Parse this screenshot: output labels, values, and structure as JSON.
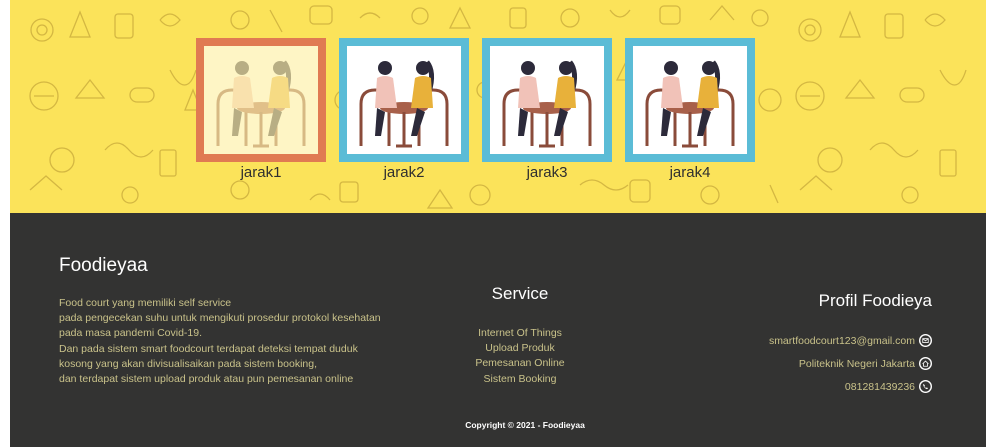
{
  "seats": [
    {
      "label": "jarak1",
      "status": "taken"
    },
    {
      "label": "jarak2",
      "status": "available"
    },
    {
      "label": "jarak3",
      "status": "available"
    },
    {
      "label": "jarak4",
      "status": "available"
    }
  ],
  "colors": {
    "banner_yellow": "#fbe35a",
    "seat_available": "#5bbcd6",
    "seat_taken": "#e07a52",
    "footer_bg": "#333332",
    "footer_text": "#c9c28a"
  },
  "footer": {
    "brand": "Foodieyaa",
    "about_lines": [
      "Food court yang memiliki self service",
      "pada pengecekan suhu untuk mengikuti prosedur protokol kesehatan",
      "pada masa pandemi Covid-19.",
      "Dan pada sistem smart foodcourt terdapat deteksi tempat duduk",
      "kosong yang akan divisualisaikan pada sistem booking,",
      "dan terdapat sistem upload produk atau pun pemesanan online"
    ],
    "service_title": "Service",
    "services": [
      "Internet Of Things",
      "Upload Produk",
      "Pemesanan Online",
      "Sistem Booking"
    ],
    "profile_title": "Profil Foodieya",
    "email": "smartfoodcourt123@gmail.com",
    "institution": "Politeknik Negeri Jakarta",
    "phone": "081281439236",
    "copyright": "Copyright © 2021 - Foodieyaa"
  },
  "icons": {
    "email": "mail-icon",
    "institution": "home-icon",
    "phone": "phone-icon"
  }
}
